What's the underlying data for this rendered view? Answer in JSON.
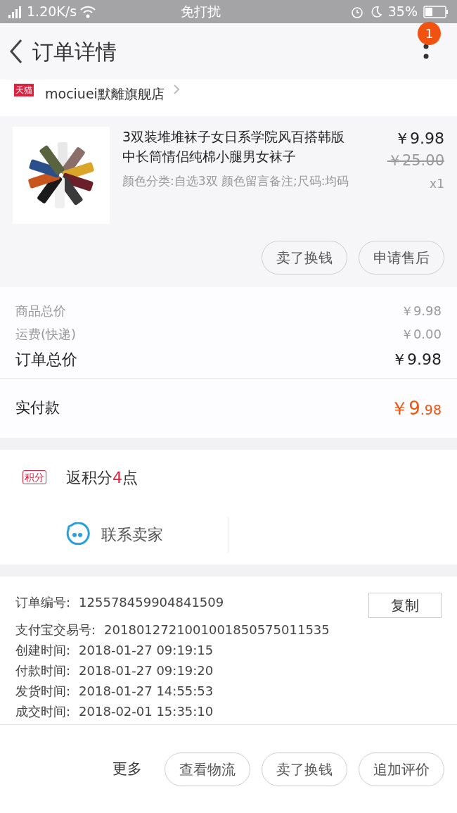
{
  "status_bar": {
    "speed": "1.20K/s",
    "mode": "免打扰",
    "battery": "35%"
  },
  "header": {
    "title": "订单详情",
    "badge": "1"
  },
  "shop": {
    "tag": "天猫",
    "name": "mociuei默離旗舰店"
  },
  "product": {
    "title": "3双装堆堆袜子女日系学院风百搭韩版中长筒情侣纯棉小腿男女袜子",
    "sku": "颜色分类:自选3双 颜色留言备注;尺码:均码",
    "price": "￥9.98",
    "original_price": "￥25.00",
    "quantity": "x1",
    "buttons": [
      "卖了换钱",
      "申请售后"
    ]
  },
  "summary": [
    {
      "label": "商品总价",
      "value": "￥9.98",
      "kind": "minor"
    },
    {
      "label": "运费(快递)",
      "value": "￥0.00",
      "kind": "minor"
    },
    {
      "label": "订单总价",
      "value": "￥9.98",
      "kind": "major"
    }
  ],
  "payment": {
    "label": "实付款",
    "amount_main": "￥9",
    "amount_decimal": ".98"
  },
  "points": {
    "tag": "积分",
    "prefix": "返积分",
    "highlight": "4",
    "suffix": "点"
  },
  "contact": {
    "label": "联系卖家"
  },
  "info": [
    {
      "label": "订单编号:",
      "value": "125578459904841509"
    },
    {
      "label": "支付宝交易号:",
      "value": "2018012721001001850575011535"
    },
    {
      "label": "创建时间:",
      "value": "2018-01-27 09:19:15"
    },
    {
      "label": "付款时间:",
      "value": "2018-01-27 09:19:20"
    },
    {
      "label": "发货时间:",
      "value": "2018-01-27 14:55:53"
    },
    {
      "label": "成交时间:",
      "value": "2018-02-01 15:35:10"
    }
  ],
  "copy_button": "复制",
  "bottom_bar": {
    "more": "更多",
    "buttons": [
      "查看物流",
      "卖了换钱",
      "追加评价"
    ]
  }
}
